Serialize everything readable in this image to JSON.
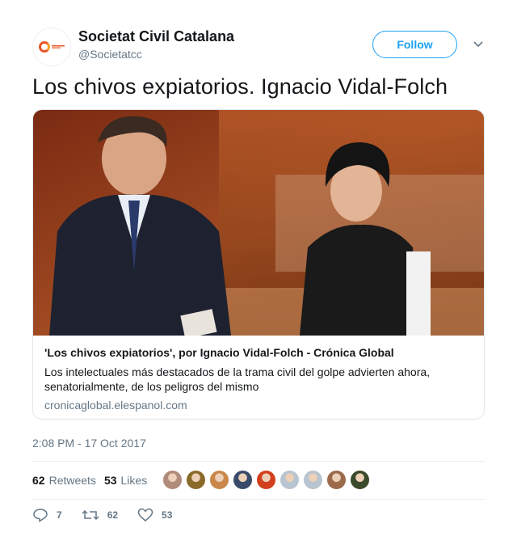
{
  "account": {
    "name": "Societat Civil Catalana",
    "handle": "@Societatcc",
    "avatar_icon": "societat-civil-catalana-logo",
    "follow_label": "Follow",
    "accent_color": "#1da1f2"
  },
  "tweet": {
    "text": "Los chivos expiatorios. Ignacio Vidal-Folch",
    "timestamp": "2:08 PM - 17 Oct 2017"
  },
  "card": {
    "image_alt": "photo-two-politicians-parliament",
    "title": "'Los chivos expiatorios', por Ignacio Vidal-Folch - Crónica Global",
    "description": "Los intelectuales más destacados de la trama civil del golpe advierten ahora, senatorialmente, de los peligros del mismo",
    "domain": "cronicaglobal.elespanol.com"
  },
  "stats": {
    "retweets_count": "62",
    "retweets_label": "Retweets",
    "likes_count": "53",
    "likes_label": "Likes"
  },
  "likers": [
    {
      "icon": "liker-avatar",
      "color": "#b08a7a"
    },
    {
      "icon": "liker-avatar",
      "color": "#8a6a2a"
    },
    {
      "icon": "liker-avatar",
      "color": "#c9884a"
    },
    {
      "icon": "liker-avatar",
      "color": "#3a4a6a"
    },
    {
      "icon": "liker-avatar",
      "color": "#d2401e"
    },
    {
      "icon": "liker-avatar",
      "color": "#b8c4d0"
    },
    {
      "icon": "liker-avatar",
      "color": "#b8c4d0"
    },
    {
      "icon": "liker-avatar",
      "color": "#9a6a4a"
    },
    {
      "icon": "liker-avatar",
      "color": "#3a4a2a"
    }
  ],
  "actions": {
    "reply_count": "7",
    "retweet_count": "62",
    "like_count": "53"
  }
}
